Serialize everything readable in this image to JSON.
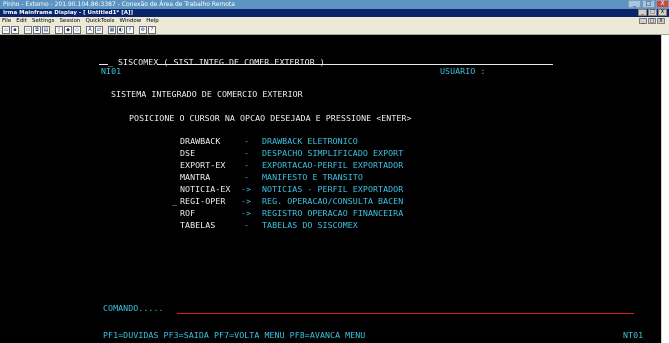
{
  "rdp_window": {
    "title": "Pinho - Externo - 201.90.104.86:3387 - Conexão de Área de Trabalho Remota",
    "controls": [
      "_",
      "□",
      "X"
    ]
  },
  "app_window": {
    "title": "Irma Mainframe Display - [ Untitled1* [A]]",
    "controls": [
      "_",
      "□",
      "X"
    ]
  },
  "menu": {
    "items": [
      "File",
      "Edit",
      "Settings",
      "Session",
      "QuickTools",
      "Window",
      "Help"
    ],
    "mdi_controls": [
      "_",
      "□",
      "X"
    ]
  },
  "toolbar": {
    "icons": [
      "new-icon",
      "save-icon",
      "print-icon",
      "copy-icon",
      "paste-icon",
      "find-icon",
      "connect-icon",
      "disconnect-icon",
      "macro-icon",
      "transfer-icon",
      "keyboard-icon",
      "color-icon",
      "font-icon",
      "settings-icon",
      "help-icon"
    ]
  },
  "terminal": {
    "header_title": "SISCOMEX ( SIST.INTEG.DE COMER.EXTERIOR )",
    "header_cursor": "_",
    "screen_id": "NI01",
    "user_label": "USUARIO :",
    "system_title": "SISTEMA INTEGRADO DE COMERCIO EXTERIOR",
    "instruction": "POSICIONE O CURSOR NA OPCAO DESEJADA E PRESSIONE <ENTER>",
    "options": [
      {
        "code": "DRAWBACK",
        "sep": "-",
        "desc": "DRAWBACK ELETRONICO"
      },
      {
        "code": "DSE",
        "sep": "-",
        "desc": "DESPACHO SIMPLIFICADO EXPORT"
      },
      {
        "code": "EXPORT-EX",
        "sep": "-",
        "desc": "EXPORTACAO-PERFIL EXPORTADOR"
      },
      {
        "code": "MANTRA",
        "sep": "-",
        "desc": "MANIFESTO E TRANSITO"
      },
      {
        "code": "NOTICIA-EX",
        "sep": "->",
        "desc": "NOTICIAS - PERFIL EXPORTADOR"
      },
      {
        "code": "REGI-OPER",
        "sep": "->",
        "desc": "REG. OPERACAO/CONSULTA BACEN"
      },
      {
        "code": "ROF",
        "sep": "->",
        "desc": "REGISTRO OPERACAO FINANCEIRA"
      },
      {
        "code": "TABELAS",
        "sep": "-",
        "desc": "TABELAS DO SISCOMEX"
      }
    ],
    "selection_cursor": "_",
    "command_label": "COMANDO.....",
    "command_value": "",
    "function_keys": "PF1=DUVIDAS PF3=SAIDA PF7=VOLTA MENU PF8=AVANCA MENU",
    "terminal_id": "NT01"
  },
  "colors": {
    "background": "#000000",
    "text_white": "#f2f2f2",
    "text_cyan": "#3ec3e3",
    "field_red": "#e01818"
  }
}
